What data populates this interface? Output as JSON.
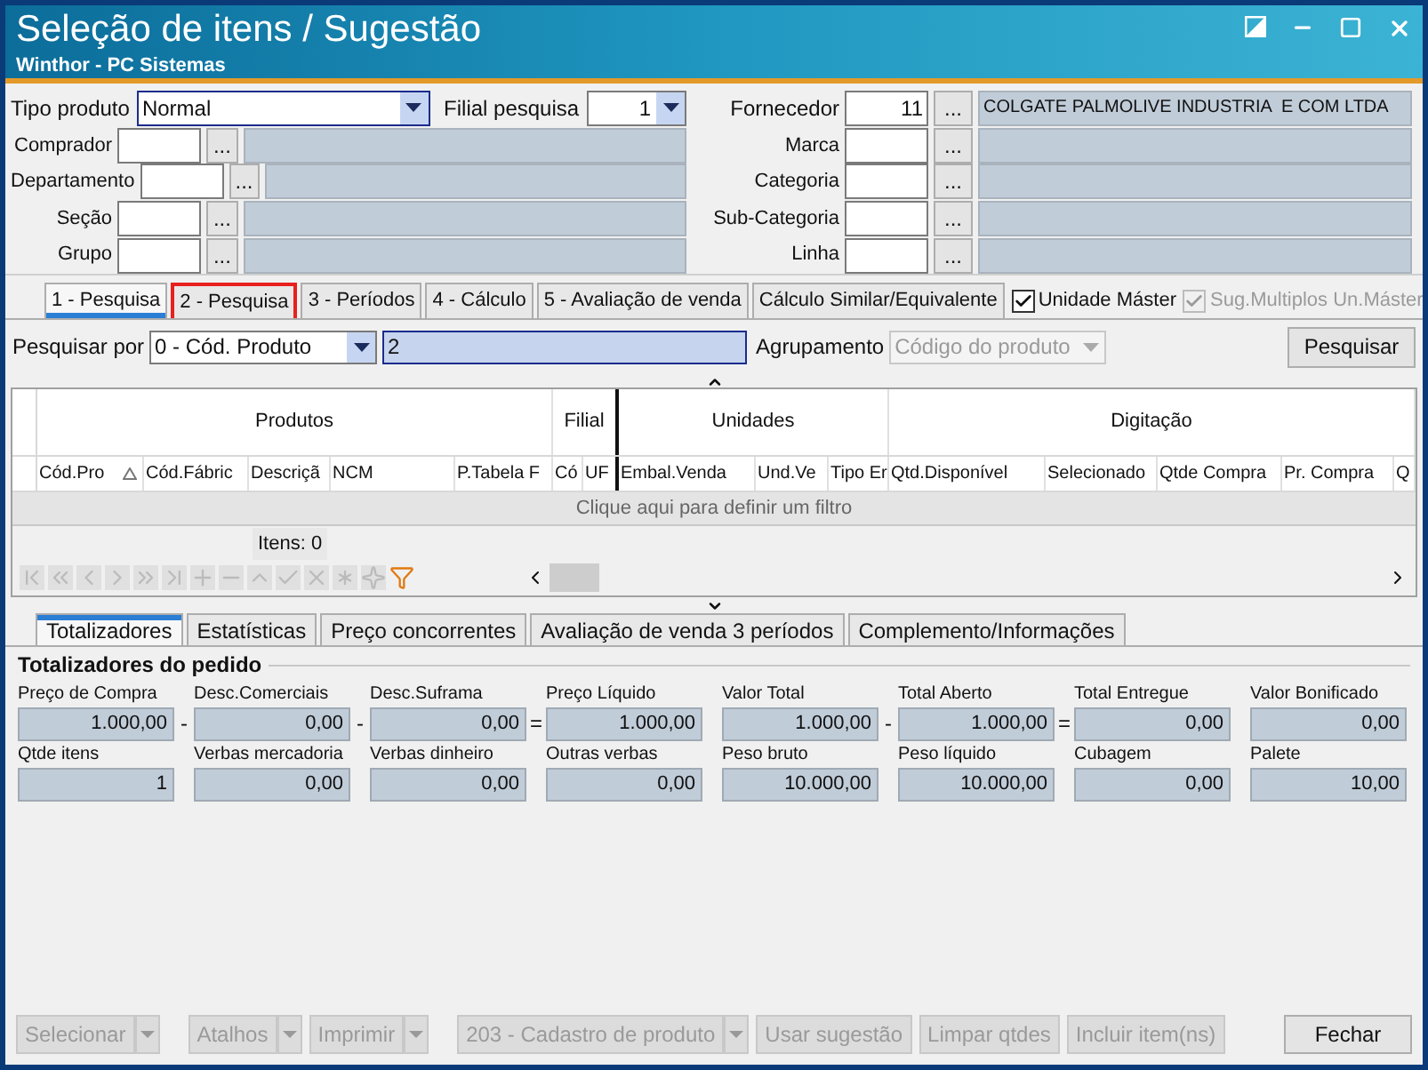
{
  "window": {
    "title": "Seleção de itens / Sugestão",
    "subtitle": "Winthor - PC Sistemas"
  },
  "filters": {
    "tipo_produto": {
      "label": "Tipo produto",
      "value": "Normal"
    },
    "filial_pesquisa": {
      "label": "Filial pesquisa",
      "value": "1"
    },
    "fornecedor": {
      "label": "Fornecedor",
      "code": "11",
      "button": "...",
      "name": "COLGATE PALMOLIVE INDUSTRIA  E COM LTDA"
    },
    "left": [
      {
        "label": "Comprador",
        "button": "..."
      },
      {
        "label": "Departamento",
        "button": "..."
      },
      {
        "label": "Seção",
        "button": "..."
      },
      {
        "label": "Grupo",
        "button": "..."
      }
    ],
    "right": [
      {
        "label": "Marca",
        "button": "..."
      },
      {
        "label": "Categoria",
        "button": "..."
      },
      {
        "label": "Sub-Categoria",
        "button": "..."
      },
      {
        "label": "Linha",
        "button": "..."
      }
    ]
  },
  "tabs": [
    {
      "label": "1 - Pesquisa",
      "selected": true,
      "highlighted": false
    },
    {
      "label": "2 - Pesquisa",
      "selected": false,
      "highlighted": true
    },
    {
      "label": "3 - Períodos",
      "selected": false,
      "highlighted": false
    },
    {
      "label": "4 - Cálculo",
      "selected": false,
      "highlighted": false
    },
    {
      "label": "5 - Avaliação de venda",
      "selected": false,
      "highlighted": false
    },
    {
      "label": "Cálculo Similar/Equivalente",
      "selected": false,
      "highlighted": false
    }
  ],
  "options": [
    {
      "label": "Unidade Máster",
      "checked": true,
      "disabled": false
    },
    {
      "label": "Sug.Multiplos Un.Máster",
      "checked": true,
      "disabled": true
    }
  ],
  "search": {
    "label": "Pesquisar por",
    "mode": "0 - Cód. Produto",
    "value": "2",
    "grouping_label": "Agrupamento",
    "grouping": "Código do produto",
    "button": "Pesquisar"
  },
  "grid": {
    "groups": [
      "Produtos",
      "Filial",
      "Unidades",
      "Digitação"
    ],
    "columns": [
      {
        "label": "Cód.Pro",
        "sorted": true
      },
      {
        "label": "Cód.Fábric",
        "sorted": false
      },
      {
        "label": "Descriçã",
        "sorted": false
      },
      {
        "label": "NCM",
        "sorted": false
      },
      {
        "label": "P.Tabela F",
        "sorted": false
      },
      {
        "label": "Có",
        "sorted": false
      },
      {
        "label": "UF",
        "sorted": false
      },
      {
        "label": "Embal.Venda",
        "sorted": false
      },
      {
        "label": "Und.Ve",
        "sorted": false
      },
      {
        "label": "Tipo Er",
        "sorted": false
      },
      {
        "label": "Qtd.Disponível",
        "sorted": false
      },
      {
        "label": "Selecionado",
        "sorted": false
      },
      {
        "label": "Qtde Compra",
        "sorted": false
      },
      {
        "label": "Pr. Compra",
        "sorted": false
      },
      {
        "label": "Q",
        "sorted": false
      }
    ],
    "filter_hint": "Clique aqui para definir um filtro",
    "footer": "Itens: 0"
  },
  "bottom_tabs": [
    {
      "label": "Totalizadores",
      "selected": true
    },
    {
      "label": "Estatísticas",
      "selected": false
    },
    {
      "label": "Preço concorrentes",
      "selected": false
    },
    {
      "label": "Avaliação de venda 3 períodos",
      "selected": false
    },
    {
      "label": "Complemento/Informações",
      "selected": false
    }
  ],
  "totals": {
    "title": "Totalizadores do pedido",
    "rows": [
      [
        {
          "label": "Preço de Compra",
          "value": "1.000,00",
          "op": "-"
        },
        {
          "label": "Desc.Comerciais",
          "value": "0,00",
          "op": "-"
        },
        {
          "label": "Desc.Suframa",
          "value": "0,00",
          "op": "="
        },
        {
          "label": "Preço Líquido",
          "value": "1.000,00"
        },
        {
          "label": "Valor Total",
          "value": "1.000,00",
          "op": "-"
        },
        {
          "label": "Total Aberto",
          "value": "1.000,00",
          "op": "="
        },
        {
          "label": "Total Entregue",
          "value": "0,00"
        },
        {
          "label": "Valor Bonificado",
          "value": "0,00"
        }
      ],
      [
        {
          "label": "Qtde itens",
          "value": "1"
        },
        {
          "label": "Verbas mercadoria",
          "value": "0,00"
        },
        {
          "label": "Verbas dinheiro",
          "value": "0,00"
        },
        {
          "label": "Outras verbas",
          "value": "0,00"
        },
        {
          "label": "Peso bruto",
          "value": "10.000,00"
        },
        {
          "label": "Peso líquido",
          "value": "10.000,00"
        },
        {
          "label": "Cubagem",
          "value": "0,00"
        },
        {
          "label": "Palete",
          "value": "10,00"
        }
      ]
    ]
  },
  "buttons": [
    {
      "label": "Selecionar",
      "disabled": true,
      "dropdown": true
    },
    {
      "label": "Atalhos",
      "disabled": true,
      "dropdown": true
    },
    {
      "label": "Imprimir",
      "disabled": true,
      "dropdown": true
    },
    {
      "label": "203 - Cadastro de produto",
      "disabled": true,
      "dropdown": true
    },
    {
      "label": "Usar sugestão",
      "disabled": true,
      "dropdown": false
    },
    {
      "label": "Limpar qtdes",
      "disabled": true,
      "dropdown": false
    },
    {
      "label": "Incluir item(ns)",
      "disabled": true,
      "dropdown": false
    },
    {
      "label": "Fechar",
      "disabled": false,
      "dropdown": false
    }
  ]
}
